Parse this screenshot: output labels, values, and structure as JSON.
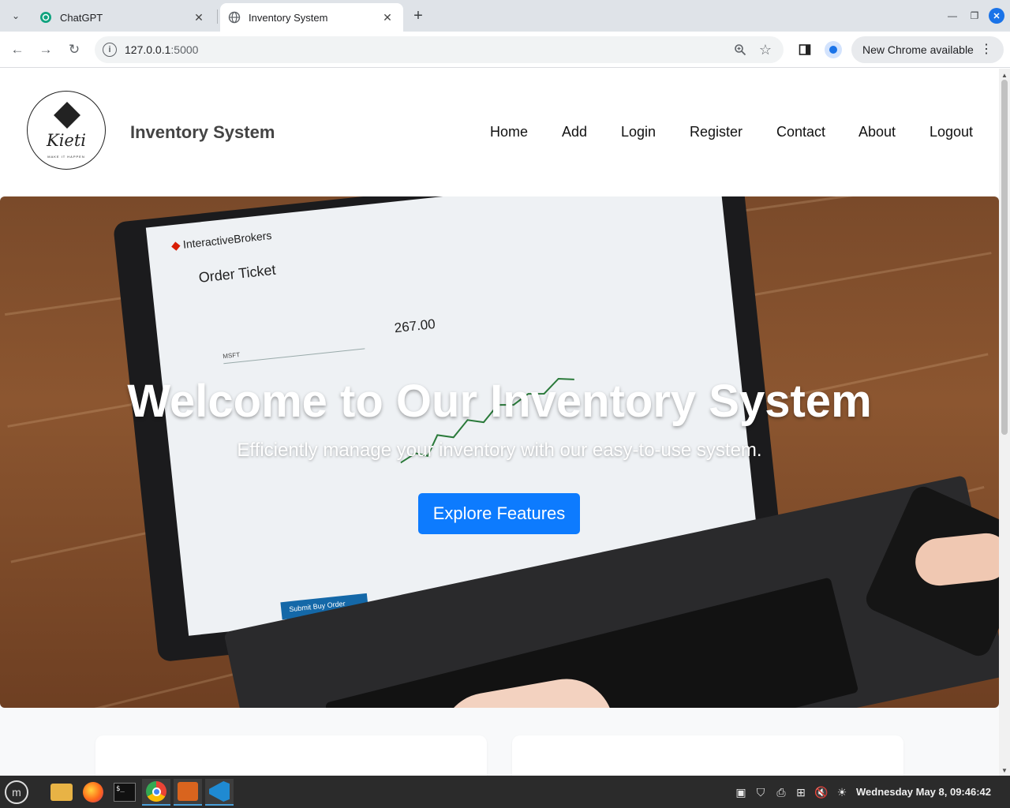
{
  "browser": {
    "tabs": [
      {
        "title": "ChatGPT",
        "icon": "chatgpt-icon"
      },
      {
        "title": "Inventory System",
        "icon": "globe-icon"
      }
    ],
    "url_host": "127.0.0.1",
    "url_port": ":5000",
    "update_chip": "New Chrome available"
  },
  "site": {
    "logo_text": "Kieti",
    "logo_tagline": "MAKE IT HAPPEN",
    "brand": "Inventory System",
    "nav": [
      "Home",
      "Add",
      "Login",
      "Register",
      "Contact",
      "About",
      "Logout"
    ]
  },
  "hero": {
    "title": "Welcome to Our Inventory System",
    "subtitle": "Efficiently manage your inventory with our easy-to-use system.",
    "button": "Explore Features",
    "image_text": {
      "brand": "InteractiveBrokers",
      "heading": "Order Ticket",
      "symbol": "MSFT",
      "price": "267.00",
      "submit": "Submit Buy Order"
    }
  },
  "taskbar": {
    "clock": "Wednesday May  8, 09:46:42"
  },
  "colors": {
    "primary_button": "#0d7bfe",
    "active_tab_indicator": "#4a9fd8"
  }
}
